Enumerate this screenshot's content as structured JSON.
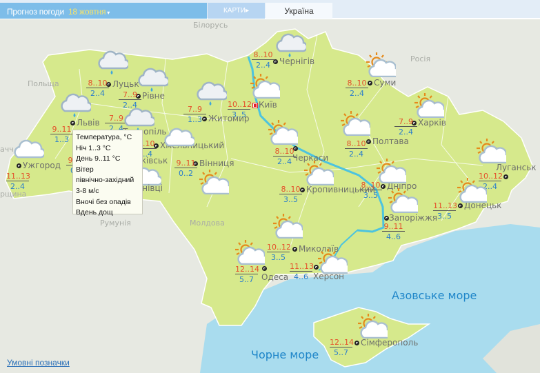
{
  "header": {
    "title": "Прогноз погоди",
    "date": "18 жовтня",
    "caret": "▾",
    "maps_tab": "КАРТИ",
    "maps_arrow": "▸",
    "region_tab": "Україна"
  },
  "countries": [
    "Білорусь",
    "Польща",
    "Росія",
    "Румунія",
    "Молдова",
    "ачч",
    "рщина"
  ],
  "seas": [
    "Азовське море",
    "Чорне море"
  ],
  "colors": {
    "land": "#d6e98c",
    "sea": "#a9dcee",
    "river": "#4cc3df",
    "day_temp": "#e4502a",
    "night_temp": "#2a7dcb",
    "header": "#7dbde9"
  },
  "cities": [
    {
      "name": "Луцьк",
      "day": "8..10",
      "night": "2..4",
      "icon": "cloud-rain"
    },
    {
      "name": "Рівне",
      "day": "7..9",
      "night": "2..4",
      "icon": "cloud-rain"
    },
    {
      "name": "Львів",
      "day": "9..11",
      "night": "1..3",
      "icon": "cloud-rain"
    },
    {
      "name": "Тернопіль",
      "day": "7..9",
      "night": "2..4",
      "icon": "cloud-rain"
    },
    {
      "name": "Хмельницький",
      "day": "8..10",
      "night": "2..4",
      "icon": "cloud"
    },
    {
      "name": "Ужгород",
      "day": "11..13",
      "night": "2..4",
      "icon": "cloud"
    },
    {
      "name": "Івано-Франківськ",
      "day": "9..11",
      "night": "0..2",
      "icon": "cloud"
    },
    {
      "name": "Чернівці",
      "day": "9..11",
      "night": "1..3",
      "icon": ""
    },
    {
      "name": "Житомир",
      "day": "7..9",
      "night": "1..3",
      "icon": "cloud-rain"
    },
    {
      "name": "Вінниця",
      "day": "9..11",
      "night": "0..2",
      "icon": "sun-cloud"
    },
    {
      "name": "Чернігів",
      "day": "8..10",
      "night": "2..4",
      "icon": "cloud-rain"
    },
    {
      "name": "Київ",
      "day": "10..12",
      "night": "3..5",
      "icon": "sun-cloud",
      "capital": true
    },
    {
      "name": "Суми",
      "day": "8..10",
      "night": "2..4",
      "icon": "sun-cloud"
    },
    {
      "name": "Харків",
      "day": "7..9",
      "night": "2..4",
      "icon": "sun-cloud"
    },
    {
      "name": "Полтава",
      "day": "8..10",
      "night": "2..4",
      "icon": "sun-cloud"
    },
    {
      "name": "Черкаси",
      "day": "8..10",
      "night": "2..4",
      "icon": "sun-cloud"
    },
    {
      "name": "Кропивницький",
      "day": "8..10",
      "night": "3..5",
      "icon": "sun-cloud"
    },
    {
      "name": "Дніпро",
      "day": "8..10",
      "night": "3..5",
      "icon": "sun-cloud"
    },
    {
      "name": "Запоріжжя",
      "day": "9..11",
      "night": "4..6",
      "icon": "sun-cloud"
    },
    {
      "name": "Луганськ",
      "day": "10..12",
      "night": "2..4",
      "icon": "sun-cloud"
    },
    {
      "name": "Донецьк",
      "day": "11..13",
      "night": "3..5",
      "icon": "sun-cloud"
    },
    {
      "name": "Миколаїв",
      "day": "10..12",
      "night": "3..5",
      "icon": "sun-cloud"
    },
    {
      "name": "Одеса",
      "day": "12..14",
      "night": "5..7",
      "icon": "sun-cloud"
    },
    {
      "name": "Херсон",
      "day": "11..13",
      "night": "4..6",
      "icon": "sun-cloud"
    },
    {
      "name": "Сімферополь",
      "day": "12..14",
      "night": "5..7",
      "icon": "sun-cloud"
    }
  ],
  "tooltip": {
    "lines": [
      "Температура, °C",
      "Ніч 1..3 °C",
      "День 9..11 °C",
      "Вітер",
      "північно-західний",
      "3-8 м/с",
      "Вночі без опадів",
      "Вдень дощ"
    ]
  },
  "legend_link": "Умовні позначки"
}
